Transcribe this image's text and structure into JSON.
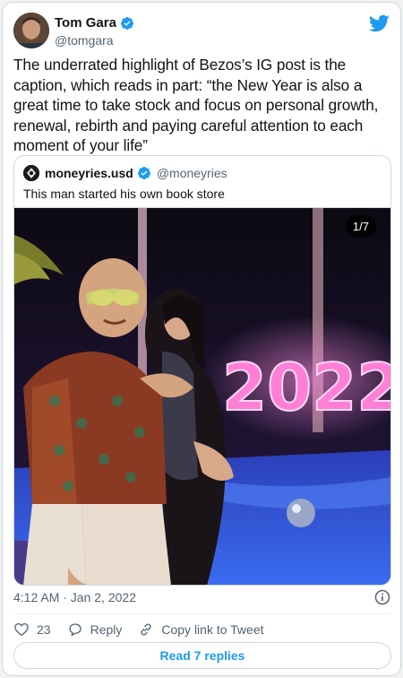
{
  "author": {
    "name": "Tom Gara",
    "handle": "@tomgara"
  },
  "tweet": {
    "text": "The underrated highlight of Bezos’s IG post is the caption, which reads in part: “the New Year is also a great time to take stock and focus on personal growth, renewal, rebirth and paying careful attention to each moment of your life”"
  },
  "quoted": {
    "name": "moneyries.usd",
    "handle": "@moneyries",
    "text": "This man started his own book store",
    "photo_counter": "1/7",
    "sign_text": "2022"
  },
  "meta": {
    "timestamp": "4:12 AM · Jan 2, 2022"
  },
  "actions": {
    "like_count": "23",
    "reply_label": "Reply",
    "copy_label": "Copy link to Tweet",
    "read_replies_label": "Read 7 replies"
  },
  "colors": {
    "accent": "#1d9bf0",
    "text": "#0f1419",
    "muted": "#536471",
    "border": "#cfd9de"
  }
}
